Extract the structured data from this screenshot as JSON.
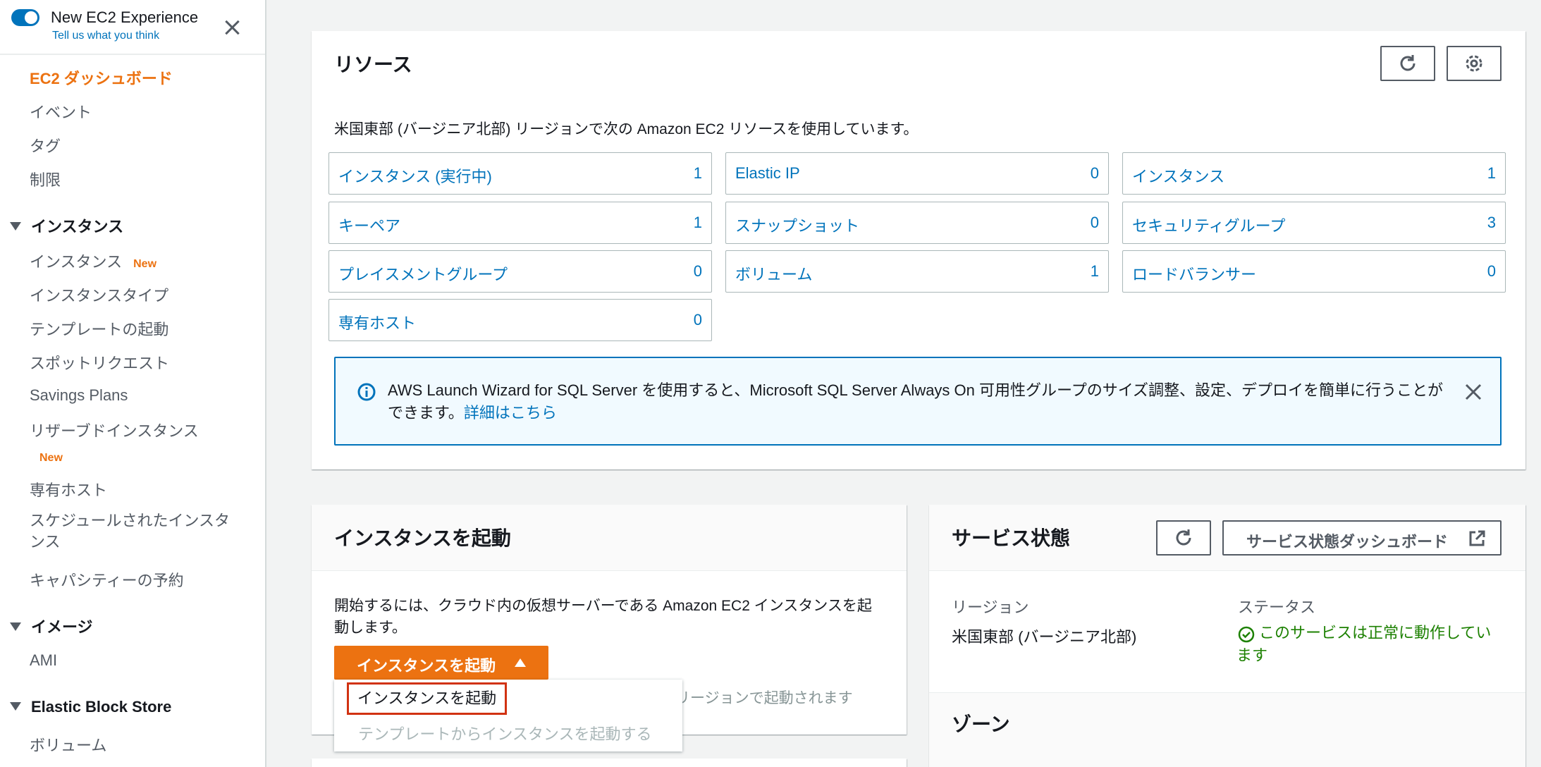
{
  "sidebar": {
    "experience_title": "New EC2 Experience",
    "experience_sub": "Tell us what you think",
    "items": {
      "dashboard": "EC2 ダッシュボード",
      "events": "イベント",
      "tags": "タグ",
      "limits": "制限",
      "sec_instances": "インスタンス",
      "instances": "インスタンス",
      "instances_badge": "New",
      "instance_types": "インスタンスタイプ",
      "launch_templates": "テンプレートの起動",
      "spot_requests": "スポットリクエスト",
      "savings_plans": "Savings Plans",
      "reserved_instances": "リザーブドインスタンス",
      "reserved_badge": "New",
      "dedicated_hosts": "専有ホスト",
      "scheduled_instances": "スケジュールされたインスタンス",
      "capacity_reservations": "キャパシティーの予約",
      "sec_images": "イメージ",
      "ami": "AMI",
      "sec_ebs": "Elastic Block Store",
      "volumes": "ボリューム"
    }
  },
  "resources": {
    "title": "リソース",
    "description": "米国東部 (バージニア北部) リージョンで次の Amazon EC2 リソースを使用しています。",
    "cells": [
      {
        "label": "インスタンス (実行中)",
        "value": "1"
      },
      {
        "label": "Elastic IP",
        "value": "0"
      },
      {
        "label": "インスタンス",
        "value": "1"
      },
      {
        "label": "キーペア",
        "value": "1"
      },
      {
        "label": "スナップショット",
        "value": "0"
      },
      {
        "label": "セキュリティグループ",
        "value": "3"
      },
      {
        "label": "プレイスメントグループ",
        "value": "0"
      },
      {
        "label": "ボリューム",
        "value": "1"
      },
      {
        "label": "ロードバランサー",
        "value": "0"
      },
      {
        "label": "専有ホスト",
        "value": "0"
      }
    ],
    "info_text": "AWS Launch Wizard for SQL Server を使用すると、Microsoft SQL Server Always On 可用性グループのサイズ調整、設定、デプロイを簡単に行うことができます。",
    "info_link": "詳細はこちら"
  },
  "launch": {
    "title": "インスタンスを起動",
    "description": "開始するには、クラウド内の仮想サーバーである Amazon EC2 インスタンスを起動します。",
    "button_label": "インスタンスを起動",
    "dropdown_item1": "インスタンスを起動",
    "dropdown_item2": "テンプレートからインスタンスを起動する",
    "note_partial": "リージョンで起動されます"
  },
  "service_health": {
    "title": "サービス状態",
    "dashboard_button": "サービス状態ダッシュボード",
    "region_label": "リージョン",
    "region_value": "米国東部 (バージニア北部)",
    "status_label": "ステータス",
    "status_value": "このサービスは正常に動作しています",
    "zones_title": "ゾーン"
  },
  "icons": {
    "toggle": "toggle-switch",
    "close": "close-icon",
    "refresh": "refresh-icon",
    "settings": "gear-icon",
    "info": "info-icon",
    "external": "external-link-icon",
    "status": "check-circle-icon"
  },
  "colors": {
    "accent_orange": "#ec7211",
    "link_blue": "#0073bb",
    "success_green": "#1d8102",
    "highlight_red": "#d13212"
  }
}
